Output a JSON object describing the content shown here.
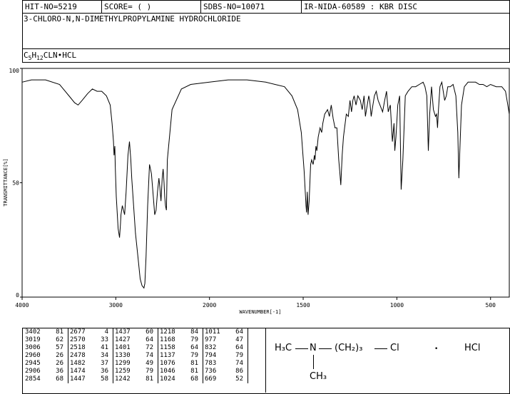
{
  "header": {
    "hit_no": "HIT-NO=5219",
    "score": "SCORE=  (    )",
    "sdbs_no": "SDBS-NO=10071",
    "ir_id": "IR-NIDA-60589 : KBR DISC"
  },
  "compound_name": "3-CHLORO-N,N-DIMETHYLPROPYLAMINE HYDROCHLORIDE",
  "formula": {
    "c": "5",
    "h": "12",
    "rest": "CLN•HCL"
  },
  "chart_data": {
    "type": "line",
    "title": "",
    "xlabel": "WAVENUMBER[-1]",
    "ylabel": "TRANSMITTANCE[%]",
    "xlim": [
      4000,
      400
    ],
    "ylim": [
      0,
      100
    ],
    "x_ticks": [
      "4000",
      "3000",
      "2000",
      "1500",
      "1000",
      "500"
    ],
    "y_ticks": [
      "100",
      "50",
      "0"
    ],
    "series": [
      {
        "name": "",
        "x": [
          4000,
          3900,
          3750,
          3600,
          3500,
          3440,
          3402,
          3360,
          3300,
          3250,
          3200,
          3150,
          3100,
          3060,
          3040,
          3025,
          3019,
          3010,
          3006,
          2995,
          2975,
          2960,
          2950,
          2945,
          2930,
          2906,
          2890,
          2870,
          2854,
          2840,
          2830,
          2810,
          2790,
          2760,
          2740,
          2720,
          2700,
          2690,
          2677,
          2660,
          2640,
          2620,
          2600,
          2585,
          2570,
          2555,
          2540,
          2530,
          2518,
          2505,
          2495,
          2485,
          2478,
          2470,
          2460,
          2450,
          2400,
          2300,
          2200,
          2000,
          1900,
          1800,
          1700,
          1650,
          1600,
          1560,
          1530,
          1510,
          1495,
          1485,
          1482,
          1478,
          1474,
          1468,
          1460,
          1455,
          1447,
          1440,
          1437,
          1432,
          1427,
          1420,
          1410,
          1401,
          1395,
          1385,
          1370,
          1360,
          1350,
          1340,
          1330,
          1320,
          1310,
          1305,
          1299,
          1292,
          1285,
          1270,
          1259,
          1250,
          1242,
          1235,
          1228,
          1218,
          1208,
          1195,
          1185,
          1175,
          1168,
          1162,
          1158,
          1150,
          1145,
          1137,
          1128,
          1120,
          1110,
          1100,
          1090,
          1076,
          1065,
          1055,
          1046,
          1035,
          1024,
          1015,
          1011,
          1005,
          995,
          985,
          977,
          968,
          955,
          940,
          920,
          900,
          880,
          860,
          850,
          840,
          832,
          825,
          815,
          805,
          794,
          788,
          783,
          778,
          770,
          760,
          745,
          736,
          728,
          715,
          700,
          685,
          675,
          669,
          663,
          655,
          640,
          620,
          600,
          580,
          560,
          540,
          520,
          500,
          470,
          440,
          420,
          410,
          400
        ],
        "y": [
          94,
          95,
          95,
          93,
          88,
          85,
          84,
          86,
          89,
          91,
          90,
          90,
          88,
          84,
          76,
          68,
          62,
          66,
          57,
          44,
          30,
          26,
          32,
          36,
          40,
          36,
          46,
          62,
          68,
          60,
          52,
          40,
          28,
          16,
          8,
          5,
          4,
          6,
          18,
          40,
          58,
          54,
          44,
          36,
          38,
          46,
          52,
          48,
          42,
          52,
          56,
          50,
          44,
          40,
          38,
          60,
          82,
          91,
          93,
          94,
          95,
          95,
          94,
          93,
          92,
          88,
          82,
          72,
          55,
          40,
          37,
          46,
          36,
          42,
          58,
          60,
          58,
          62,
          60,
          66,
          64,
          70,
          74,
          72,
          76,
          80,
          82,
          79,
          84,
          78,
          74,
          74,
          60,
          55,
          49,
          62,
          70,
          80,
          79,
          86,
          81,
          86,
          88,
          84,
          88,
          86,
          82,
          88,
          79,
          82,
          84,
          88,
          86,
          79,
          84,
          88,
          90,
          86,
          84,
          81,
          86,
          90,
          81,
          84,
          68,
          76,
          64,
          70,
          84,
          88,
          47,
          60,
          88,
          90,
          92,
          92,
          93,
          94,
          92,
          88,
          64,
          80,
          92,
          82,
          79,
          80,
          74,
          82,
          92,
          94,
          86,
          88,
          92,
          92,
          93,
          88,
          72,
          52,
          66,
          84,
          92,
          94,
          94,
          94,
          93,
          93,
          92,
          93,
          92,
          92,
          90,
          85,
          80
        ]
      }
    ],
    "peaks": [
      {
        "wavenumber": 3402,
        "transmittance": 81
      },
      {
        "wavenumber": 3019,
        "transmittance": 62
      },
      {
        "wavenumber": 3006,
        "transmittance": 57
      },
      {
        "wavenumber": 2960,
        "transmittance": 26
      },
      {
        "wavenumber": 2945,
        "transmittance": 26
      },
      {
        "wavenumber": 2906,
        "transmittance": 36
      },
      {
        "wavenumber": 2854,
        "transmittance": 68
      },
      {
        "wavenumber": 2677,
        "transmittance": 4
      },
      {
        "wavenumber": 2570,
        "transmittance": 33
      },
      {
        "wavenumber": 2518,
        "transmittance": 41
      },
      {
        "wavenumber": 2478,
        "transmittance": 34
      },
      {
        "wavenumber": 1482,
        "transmittance": 37
      },
      {
        "wavenumber": 1474,
        "transmittance": 36
      },
      {
        "wavenumber": 1447,
        "transmittance": 58
      },
      {
        "wavenumber": 1437,
        "transmittance": 60
      },
      {
        "wavenumber": 1427,
        "transmittance": 64
      },
      {
        "wavenumber": 1401,
        "transmittance": 72
      },
      {
        "wavenumber": 1330,
        "transmittance": 74
      },
      {
        "wavenumber": 1299,
        "transmittance": 49
      },
      {
        "wavenumber": 1259,
        "transmittance": 79
      },
      {
        "wavenumber": 1242,
        "transmittance": 81
      },
      {
        "wavenumber": 1218,
        "transmittance": 84
      },
      {
        "wavenumber": 1168,
        "transmittance": 79
      },
      {
        "wavenumber": 1158,
        "transmittance": 84
      },
      {
        "wavenumber": 1137,
        "transmittance": 79
      },
      {
        "wavenumber": 1076,
        "transmittance": 81
      },
      {
        "wavenumber": 1046,
        "transmittance": 81
      },
      {
        "wavenumber": 1024,
        "transmittance": 68
      },
      {
        "wavenumber": 1011,
        "transmittance": 64
      },
      {
        "wavenumber": 977,
        "transmittance": 47
      },
      {
        "wavenumber": 832,
        "transmittance": 64
      },
      {
        "wavenumber": 794,
        "transmittance": 79
      },
      {
        "wavenumber": 783,
        "transmittance": 74
      },
      {
        "wavenumber": 736,
        "transmittance": 86
      },
      {
        "wavenumber": 669,
        "transmittance": 52
      }
    ]
  },
  "peak_table": [
    [
      [
        "3402",
        "81"
      ],
      [
        "3019",
        "62"
      ],
      [
        "3006",
        "57"
      ],
      [
        "2960",
        "26"
      ],
      [
        "2945",
        "26"
      ],
      [
        "2906",
        "36"
      ],
      [
        "2854",
        "68"
      ]
    ],
    [
      [
        "2677",
        "4"
      ],
      [
        "2570",
        "33"
      ],
      [
        "2518",
        "41"
      ],
      [
        "2478",
        "34"
      ],
      [
        "1482",
        "37"
      ],
      [
        "1474",
        "36"
      ],
      [
        "1447",
        "58"
      ]
    ],
    [
      [
        "1437",
        "60"
      ],
      [
        "1427",
        "64"
      ],
      [
        "1401",
        "72"
      ],
      [
        "1330",
        "74"
      ],
      [
        "1299",
        "49"
      ],
      [
        "1259",
        "79"
      ],
      [
        "1242",
        "81"
      ]
    ],
    [
      [
        "1218",
        "84"
      ],
      [
        "1168",
        "79"
      ],
      [
        "1158",
        "64"
      ],
      [
        "1137",
        "79"
      ],
      [
        "1076",
        "81"
      ],
      [
        "1046",
        "81"
      ],
      [
        "1024",
        "68"
      ]
    ],
    [
      [
        "1011",
        "64"
      ],
      [
        "977",
        "47"
      ],
      [
        "832",
        "64"
      ],
      [
        "794",
        "79"
      ],
      [
        "783",
        "74"
      ],
      [
        "736",
        "86"
      ],
      [
        "669",
        "52"
      ]
    ]
  ],
  "structure": {
    "h3c": "H₃C",
    "n": "N",
    "chain": "(CH₂)₃",
    "cl": "Cl",
    "dot": "•",
    "hcl": "HCl",
    "ch3": "CH₃"
  }
}
